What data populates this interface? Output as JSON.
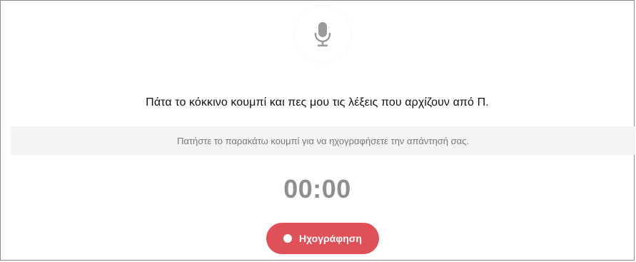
{
  "recorder": {
    "mic_icon": "microphone-icon",
    "question": "Πάτα το κόκκινο κουμπί και πες μου τις λέξεις που αρχίζουν από Π.",
    "instruction": "Πατήστε το παρακάτω κουμπί για να ηχογραφήσετε την απάντησή σας.",
    "timer": "00:00",
    "record_button_label": "Ηχογράφηση",
    "record_icon": "record-dot-icon",
    "accent_color": "#e05157",
    "timer_color": "#8f8f8f"
  }
}
